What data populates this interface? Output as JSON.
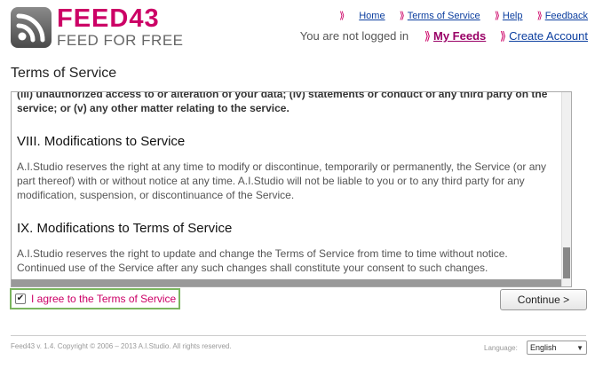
{
  "brand": {
    "name": "FEED43",
    "tagline": "FEED FOR FREE",
    "accent_color": "#cc0066",
    "logo_icon": "rss-icon"
  },
  "nav": {
    "arrow": "⟫",
    "links": [
      "Home",
      "Terms of Service",
      "Help",
      "Feedback"
    ]
  },
  "account": {
    "status": "You are not logged in",
    "my_feeds": "My Feeds",
    "create_account": "Create Account"
  },
  "page": {
    "title": "Terms of Service"
  },
  "tos": {
    "cut_text": "(iii) unauthorized access to or alteration of your data; (iv) statements or conduct of any third party on the service; or (v) any other matter relating to the service.",
    "sections": [
      {
        "heading": "VIII. Modifications to Service",
        "body": "A.I.Studio reserves the right at any time to modify or discontinue, temporarily or permanently, the Service (or any part thereof) with or without notice at any time. A.I.Studio will not be liable to you or to any third party for any modification, suspension, or discontinuance of the Service."
      },
      {
        "heading": "IX. Modifications to Terms of Service",
        "body": "A.I.Studio reserves the right to update and change the Terms of Service from time to time without notice. Continued use of the Service after any such changes shall constitute your consent to such changes."
      }
    ]
  },
  "agree": {
    "label": "I agree to the Terms of Service",
    "checked": true,
    "check_mark": "✔"
  },
  "continue_button": {
    "label": "Continue >"
  },
  "footer": {
    "copyright": "Feed43 v. 1.4. Copyright © 2006 – 2013 A.I.Studio. All rights reserved.",
    "language_label": "Language:",
    "language_value": "English",
    "dropdown_arrow": "▼"
  }
}
